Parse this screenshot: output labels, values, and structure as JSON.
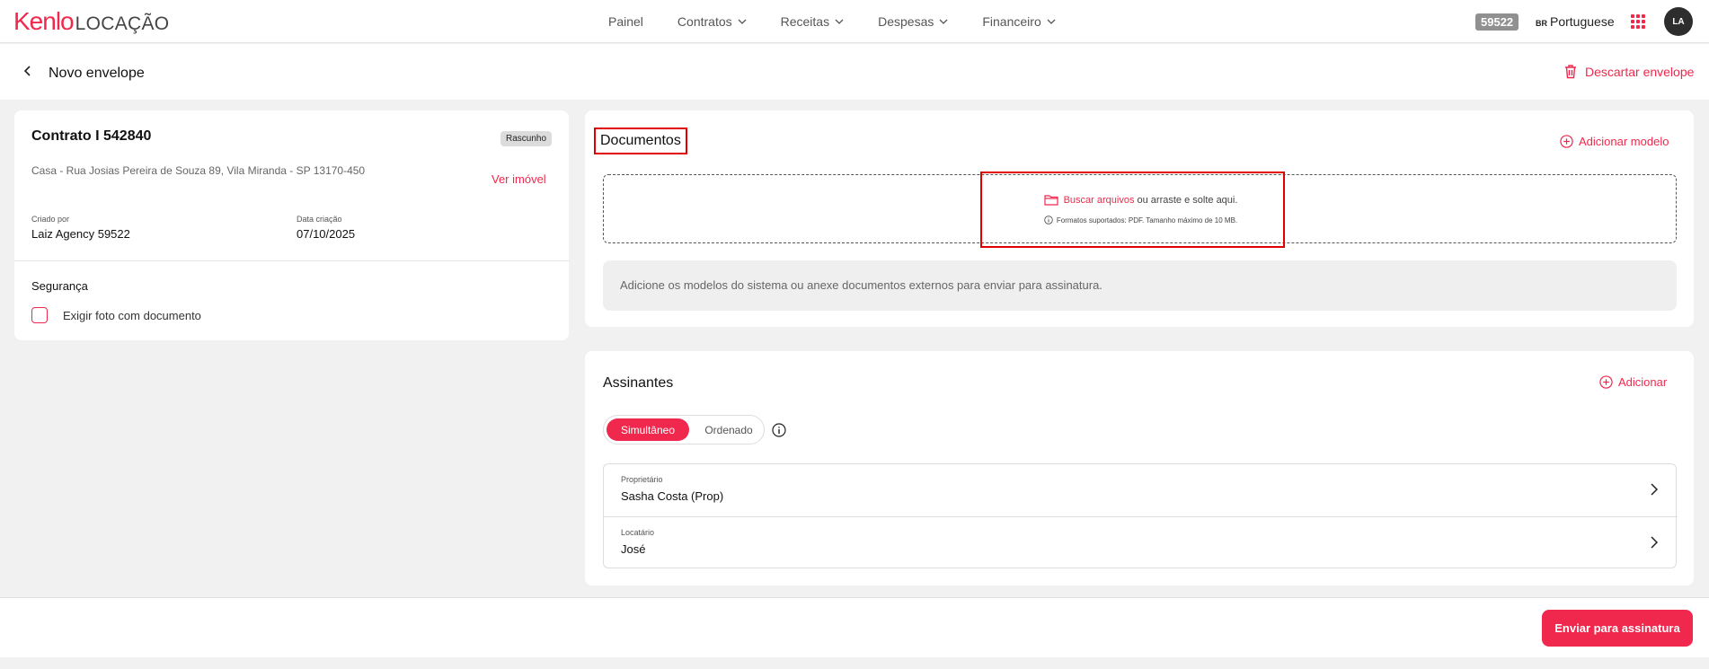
{
  "header": {
    "logo_brand": "Kenlo",
    "logo_product": "LOCAÇÃO",
    "nav": [
      {
        "label": "Painel"
      },
      {
        "label": "Contratos"
      },
      {
        "label": "Receitas"
      },
      {
        "label": "Despesas"
      },
      {
        "label": "Financeiro"
      }
    ],
    "account_badge": "59522",
    "language_flag": "BR",
    "language": "Portuguese",
    "avatar_initials": "LA"
  },
  "subheader": {
    "title": "Novo envelope",
    "discard_label": "Descartar envelope"
  },
  "contract": {
    "title": "Contrato I 542840",
    "status_badge": "Rascunho",
    "address": "Casa - Rua Josias Pereira de Souza 89, Vila Miranda - SP 13170-450",
    "view_property": "Ver imóvel",
    "created_by_label": "Criado por",
    "created_by": "Laiz Agency 59522",
    "created_date_label": "Data criação",
    "created_date": "07/10/2025",
    "security_title": "Segurança",
    "require_photo_label": "Exigir foto com documento",
    "require_photo_checked": false
  },
  "documents": {
    "title": "Documentos",
    "add_model": "Adicionar modelo",
    "browse_link": "Buscar arquivos",
    "drop_text": "ou arraste e solte aqui.",
    "formats_text": "Formatos suportados: PDF. Tamanho máximo de 10 MB.",
    "hint": "Adicione os modelos do sistema ou anexe documentos externos para enviar para assinatura."
  },
  "signers": {
    "title": "Assinantes",
    "add_label": "Adicionar",
    "mode_simultaneous": "Simultâneo",
    "mode_ordered": "Ordenado",
    "selected_mode": "Simultâneo",
    "list": [
      {
        "role": "Proprietário",
        "name": "Sasha Costa (Prop)"
      },
      {
        "role": "Locatário",
        "name": "José"
      }
    ]
  },
  "footer": {
    "send_label": "Enviar para assinatura"
  },
  "colors": {
    "accent": "#f0284d",
    "highlight_box": "#e00000"
  }
}
